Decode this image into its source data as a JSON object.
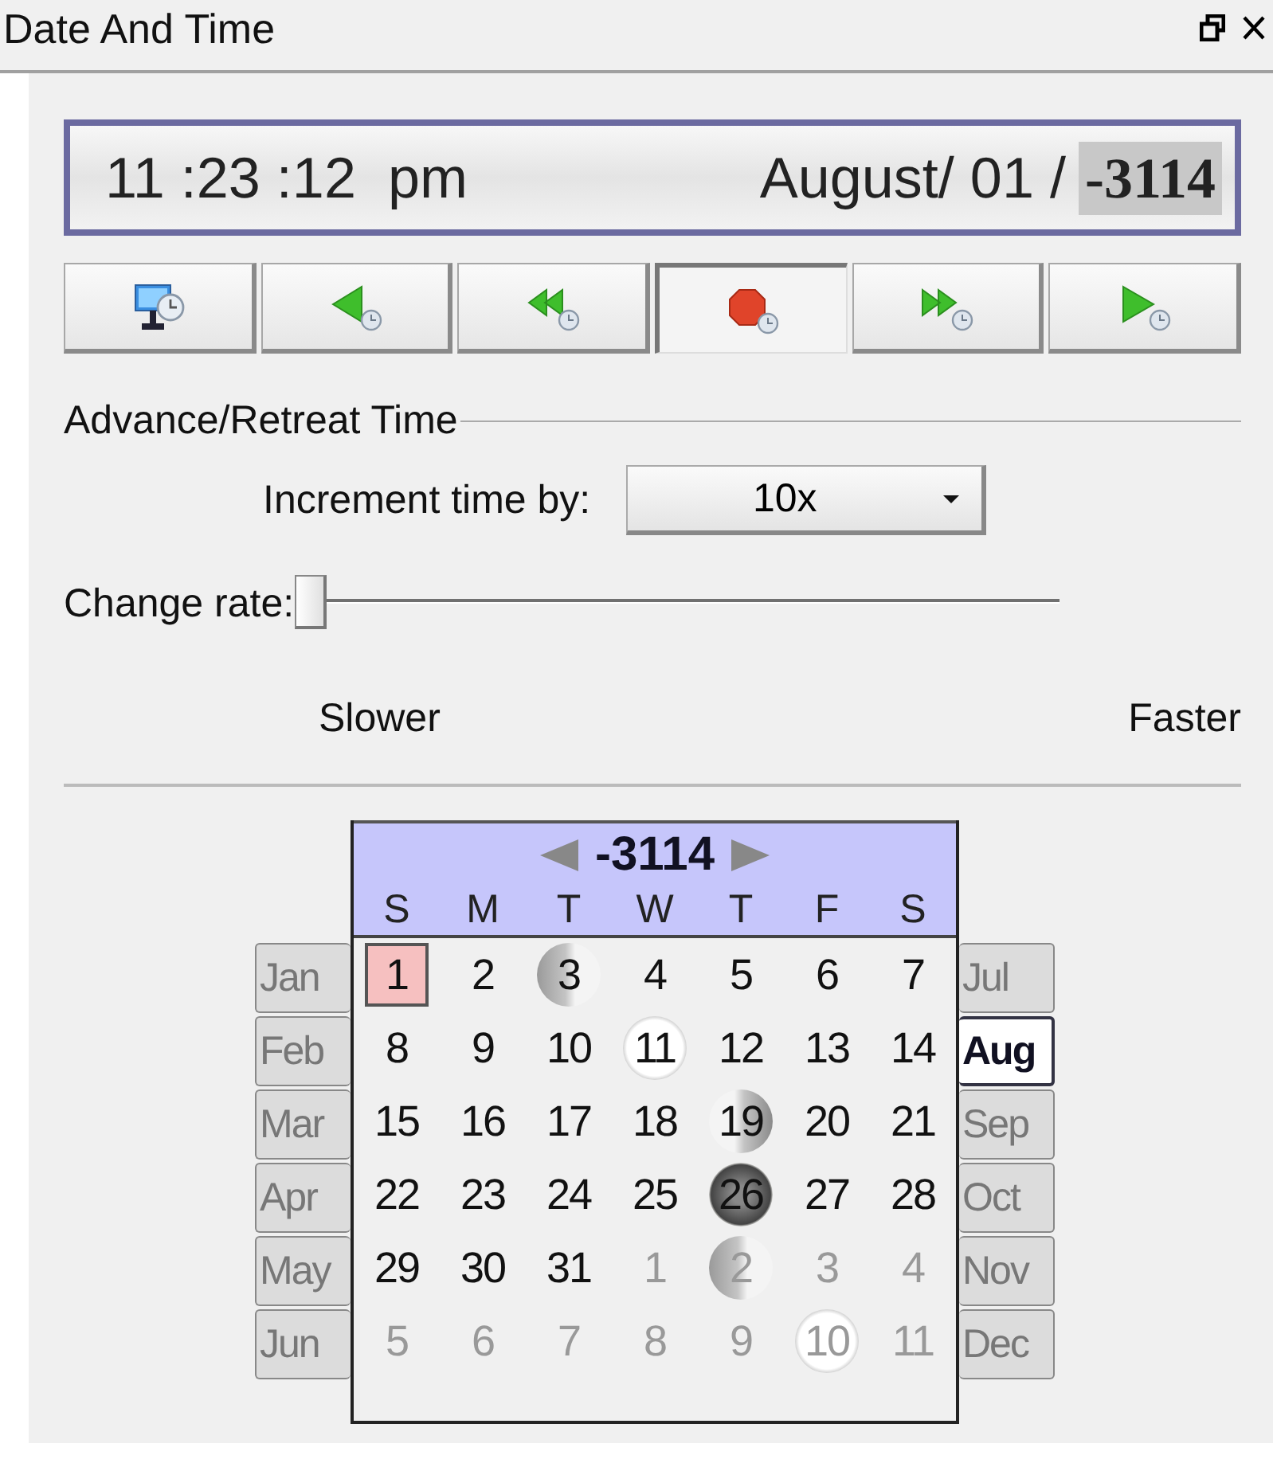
{
  "window": {
    "title": "Date And Time"
  },
  "display": {
    "time": "11 :23 :12",
    "meridiem": "pm",
    "date": "August/ 01 /",
    "year": "-3114",
    "year_selected": true
  },
  "controls": [
    {
      "kind": "system",
      "selected": false
    },
    {
      "kind": "back",
      "selected": false
    },
    {
      "kind": "rewind",
      "selected": false
    },
    {
      "kind": "stop",
      "selected": true
    },
    {
      "kind": "forward",
      "selected": false
    },
    {
      "kind": "play",
      "selected": false
    }
  ],
  "section": {
    "title": "Advance/Retreat Time",
    "increment_label": "Increment time by:",
    "increment_value": "10x",
    "rate_label": "Change rate:",
    "rate": {
      "level": 0
    },
    "slower": "Slower",
    "faster": "Faster"
  },
  "calendar": {
    "year": "-3114",
    "weekdays": [
      "S",
      "M",
      "T",
      "W",
      "T",
      "F",
      "S"
    ],
    "months_left": [
      {
        "label": "Jan",
        "selected": false
      },
      {
        "label": "Feb",
        "selected": false
      },
      {
        "label": "Mar",
        "selected": false
      },
      {
        "label": "Apr",
        "selected": false
      },
      {
        "label": "May",
        "selected": false
      },
      {
        "label": "Jun",
        "selected": false
      }
    ],
    "months_right": [
      {
        "label": "Jul",
        "selected": false
      },
      {
        "label": "Aug",
        "selected": true
      },
      {
        "label": "Sep",
        "selected": false
      },
      {
        "label": "Oct",
        "selected": false
      },
      {
        "label": "Nov",
        "selected": false
      },
      {
        "label": "Dec",
        "selected": false
      }
    ],
    "days": [
      {
        "label": "1",
        "muted": false,
        "selected": true
      },
      {
        "label": "2",
        "muted": false,
        "selected": false
      },
      {
        "label": "3",
        "muted": false,
        "selected": false,
        "kind": "waxing"
      },
      {
        "label": "4",
        "muted": false,
        "selected": false
      },
      {
        "label": "5",
        "muted": false,
        "selected": false
      },
      {
        "label": "6",
        "muted": false,
        "selected": false
      },
      {
        "label": "7",
        "muted": false,
        "selected": false
      },
      {
        "label": "8",
        "muted": false,
        "selected": false
      },
      {
        "label": "9",
        "muted": false,
        "selected": false
      },
      {
        "label": "10",
        "muted": false,
        "selected": false
      },
      {
        "label": "11",
        "muted": false,
        "selected": false,
        "kind": "full"
      },
      {
        "label": "12",
        "muted": false,
        "selected": false
      },
      {
        "label": "13",
        "muted": false,
        "selected": false
      },
      {
        "label": "14",
        "muted": false,
        "selected": false
      },
      {
        "label": "15",
        "muted": false,
        "selected": false
      },
      {
        "label": "16",
        "muted": false,
        "selected": false
      },
      {
        "label": "17",
        "muted": false,
        "selected": false
      },
      {
        "label": "18",
        "muted": false,
        "selected": false
      },
      {
        "label": "19",
        "muted": false,
        "selected": false,
        "kind": "waning"
      },
      {
        "label": "20",
        "muted": false,
        "selected": false
      },
      {
        "label": "21",
        "muted": false,
        "selected": false
      },
      {
        "label": "22",
        "muted": false,
        "selected": false
      },
      {
        "label": "23",
        "muted": false,
        "selected": false
      },
      {
        "label": "24",
        "muted": false,
        "selected": false
      },
      {
        "label": "25",
        "muted": false,
        "selected": false
      },
      {
        "label": "26",
        "muted": false,
        "selected": false,
        "kind": "new"
      },
      {
        "label": "27",
        "muted": false,
        "selected": false
      },
      {
        "label": "28",
        "muted": false,
        "selected": false
      },
      {
        "label": "29",
        "muted": false,
        "selected": false
      },
      {
        "label": "30",
        "muted": false,
        "selected": false
      },
      {
        "label": "31",
        "muted": false,
        "selected": false
      },
      {
        "label": "1",
        "muted": true,
        "selected": false
      },
      {
        "label": "2",
        "muted": true,
        "selected": false,
        "kind": "waxing"
      },
      {
        "label": "3",
        "muted": true,
        "selected": false
      },
      {
        "label": "4",
        "muted": true,
        "selected": false
      },
      {
        "label": "5",
        "muted": true,
        "selected": false
      },
      {
        "label": "6",
        "muted": true,
        "selected": false
      },
      {
        "label": "7",
        "muted": true,
        "selected": false
      },
      {
        "label": "8",
        "muted": true,
        "selected": false
      },
      {
        "label": "9",
        "muted": true,
        "selected": false
      },
      {
        "label": "10",
        "muted": true,
        "selected": false,
        "kind": "full"
      },
      {
        "label": "11",
        "muted": true,
        "selected": false
      }
    ]
  }
}
